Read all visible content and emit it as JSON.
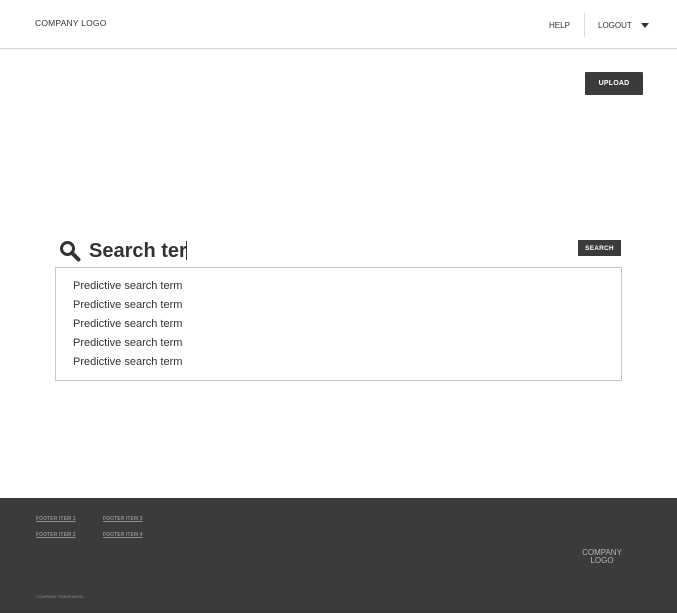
{
  "header": {
    "logo_text": "COMPANY LOGO",
    "nav": {
      "help_label": "HELP",
      "logout_label": "LOGOUT"
    },
    "icons": {
      "dropdown": "chevron-down-icon"
    }
  },
  "actions": {
    "upload_label": "UPLOAD"
  },
  "search": {
    "icon": "search-icon",
    "value": "Search ter",
    "button_label": "SEARCH",
    "suggestions": [
      "Predictive search term",
      "Predictive search term",
      "Predictive search term",
      "Predictive search term",
      "Predictive search term"
    ]
  },
  "footer": {
    "items": [
      "FOOTER ITEM 1",
      "FOOTER ITEM 2",
      "FOOTER ITEM 3",
      "FOOTER ITEM 4"
    ],
    "logo_line1": "COMPANY",
    "logo_line2": "LOGO",
    "trademark": "COMPANY TRADEMARK"
  },
  "colors": {
    "dark": "#3b3b3b",
    "text": "#333333",
    "border": "#c8c8c8",
    "footer_link": "#8f8f8f"
  }
}
